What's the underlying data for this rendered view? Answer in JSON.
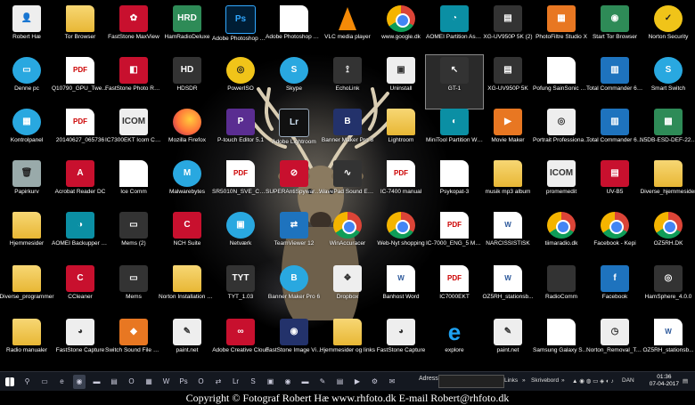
{
  "icons": [
    {
      "label": "Robert Hæ",
      "type": "white",
      "glyph": "👤",
      "icon": "user-folder-icon",
      "col": 0,
      "row": 0
    },
    {
      "label": "Tor Browser",
      "type": "folder",
      "glyph": "",
      "icon": "folder-icon",
      "col": 1,
      "row": 0
    },
    {
      "label": "FastStone MaxView",
      "type": "red",
      "glyph": "✿",
      "icon": "faststone-maxview-icon",
      "col": 2,
      "row": 0
    },
    {
      "label": "HamRadioDeluxe",
      "type": "green",
      "glyph": "HRD",
      "icon": "ham-radio-deluxe-icon",
      "col": 3,
      "row": 0
    },
    {
      "label": "Adobe Photoshop CC 2017",
      "type": "ps",
      "glyph": "Ps",
      "icon": "photoshop-icon",
      "col": 4,
      "row": 0
    },
    {
      "label": "Adobe Photoshop CC 2015.5",
      "type": "blank",
      "glyph": "",
      "icon": "blank-document-icon",
      "col": 5,
      "row": 0
    },
    {
      "label": "VLC media player",
      "type": "vlc",
      "glyph": "",
      "icon": "vlc-cone-icon",
      "col": 6,
      "row": 0
    },
    {
      "label": "www.google.dk",
      "type": "chrome",
      "glyph": "",
      "icon": "chrome-icon",
      "col": 7,
      "row": 0
    },
    {
      "label": "AOMEI Partition Assistant Pro Editi...",
      "type": "teal",
      "glyph": "◔",
      "icon": "aomei-partition-icon",
      "col": 8,
      "row": 0
    },
    {
      "label": "XG-UV950P 5K (2)",
      "type": "dark",
      "glyph": "▤",
      "icon": "radio-transceiver-icon",
      "col": 9,
      "row": 0
    },
    {
      "label": "PhotoFiltre Studio X",
      "type": "orange",
      "glyph": "▦",
      "icon": "photofiltre-icon",
      "col": 10,
      "row": 0
    },
    {
      "label": "Start Tor Browser",
      "type": "green",
      "glyph": "◉",
      "icon": "tor-onion-icon",
      "col": 11,
      "row": 0
    },
    {
      "label": "Norton Security",
      "type": "yellow",
      "glyph": "✓",
      "icon": "norton-icon",
      "col": 12,
      "row": 0
    },
    {
      "label": "Denne pc",
      "type": "lightblue",
      "glyph": "▭",
      "icon": "computer-icon",
      "col": 0,
      "row": 1
    },
    {
      "label": "Q10790_GPU_Tweak...",
      "type": "pdf",
      "glyph": "PDF",
      "icon": "pdf-icon",
      "col": 1,
      "row": 1
    },
    {
      "label": "FastStone Photo Resizer",
      "type": "red",
      "glyph": "◧",
      "icon": "faststone-resizer-icon",
      "col": 2,
      "row": 1
    },
    {
      "label": "HDSDR",
      "type": "dark",
      "glyph": "HD",
      "icon": "hdsdr-icon",
      "col": 3,
      "row": 1
    },
    {
      "label": "PowerISO",
      "type": "yellow",
      "glyph": "◎",
      "icon": "poweriso-disc-icon",
      "col": 4,
      "row": 1
    },
    {
      "label": "Skype",
      "type": "lightblue",
      "glyph": "S",
      "icon": "skype-icon",
      "col": 5,
      "row": 1
    },
    {
      "label": "EchoLink",
      "type": "dark",
      "glyph": "⟟",
      "icon": "echolink-tower-icon",
      "col": 6,
      "row": 1
    },
    {
      "label": "Uninstall",
      "type": "white",
      "glyph": "▣",
      "icon": "uninstall-icon",
      "col": 7,
      "row": 1
    },
    {
      "label": "GT-1",
      "type": "dark",
      "glyph": "↖",
      "icon": "gt1-icon",
      "col": 8,
      "row": 1,
      "selected": true
    },
    {
      "label": "XG-UV950P 5K",
      "type": "dark",
      "glyph": "▤",
      "icon": "radio-transceiver-icon",
      "col": 9,
      "row": 1
    },
    {
      "label": "Pofung SainSonic GT-1",
      "type": "blank",
      "glyph": "",
      "icon": "blank-document-icon",
      "col": 10,
      "row": 1
    },
    {
      "label": "Total Commander 64 bit (2)",
      "type": "blue",
      "glyph": "▥",
      "icon": "total-commander-icon",
      "col": 11,
      "row": 1
    },
    {
      "label": "Smart Switch",
      "type": "lightblue",
      "glyph": "S",
      "icon": "smart-switch-icon",
      "col": 12,
      "row": 1
    },
    {
      "label": "Kontrolpanel",
      "type": "lightblue",
      "glyph": "▦",
      "icon": "control-panel-icon",
      "col": 0,
      "row": 2
    },
    {
      "label": "20140627_065736",
      "type": "pdf",
      "glyph": "PDF",
      "icon": "pdf-icon",
      "col": 1,
      "row": 2
    },
    {
      "label": "IC7300EKT Icom CAT Control",
      "type": "white",
      "glyph": "ICOM",
      "icon": "icom-icon",
      "col": 2,
      "row": 2
    },
    {
      "label": "Mozilla Firefox",
      "type": "firefox",
      "glyph": "",
      "icon": "firefox-icon",
      "col": 3,
      "row": 2
    },
    {
      "label": "P-touch Editor 5.1",
      "type": "purple",
      "glyph": "P",
      "icon": "ptouch-icon",
      "col": 4,
      "row": 2
    },
    {
      "label": "Adobe Lightroom",
      "type": "lr",
      "glyph": "Lr",
      "icon": "lightroom-icon",
      "col": 5,
      "row": 2
    },
    {
      "label": "Banner Maker Pro 8",
      "type": "navy",
      "glyph": "B",
      "icon": "banner-maker-icon",
      "col": 6,
      "row": 2
    },
    {
      "label": "Lightroom",
      "type": "folder",
      "glyph": "",
      "icon": "folder-icon",
      "col": 7,
      "row": 2
    },
    {
      "label": "MiniTool Partition Wizard",
      "type": "teal",
      "glyph": "◐",
      "icon": "minitool-icon",
      "col": 8,
      "row": 2
    },
    {
      "label": "Movie Maker",
      "type": "orange",
      "glyph": "▶",
      "icon": "movie-maker-icon",
      "col": 9,
      "row": 2
    },
    {
      "label": "Portrait Professional 11",
      "type": "white",
      "glyph": "◎",
      "icon": "camera-icon",
      "col": 10,
      "row": 2
    },
    {
      "label": "Total Commander 64 bit",
      "type": "blue",
      "glyph": "▥",
      "icon": "total-commander-icon",
      "col": 11,
      "row": 2
    },
    {
      "label": "N5DB-ESD-DEF-22.6...",
      "type": "green",
      "glyph": "▩",
      "icon": "archive-icon",
      "col": 12,
      "row": 2
    },
    {
      "label": "Papirkurv",
      "type": "gray",
      "glyph": "🗑",
      "icon": "recycle-bin-icon",
      "col": 0,
      "row": 3
    },
    {
      "label": "Acrobat Reader DC",
      "type": "red",
      "glyph": "A",
      "icon": "acrobat-icon",
      "col": 1,
      "row": 3
    },
    {
      "label": "Ice Comm",
      "type": "blank",
      "glyph": "",
      "icon": "blank-document-icon",
      "col": 2,
      "row": 3
    },
    {
      "label": "Malwarebytes",
      "type": "lightblue",
      "glyph": "M",
      "icon": "malwarebytes-icon",
      "col": 3,
      "row": 3
    },
    {
      "label": "SR5010N_SVE_CD-Rom",
      "type": "pdf",
      "glyph": "PDF",
      "icon": "pdf-icon",
      "col": 4,
      "row": 3
    },
    {
      "label": "SUPERAntiSpyware Professional",
      "type": "red",
      "glyph": "⊘",
      "icon": "antispyware-icon",
      "col": 5,
      "row": 3
    },
    {
      "label": "WavePad Sound Editor",
      "type": "dark",
      "glyph": "∿",
      "icon": "wavepad-icon",
      "col": 6,
      "row": 3
    },
    {
      "label": "IC-7400 manual",
      "type": "pdf",
      "glyph": "PDF",
      "icon": "pdf-icon",
      "col": 7,
      "row": 3
    },
    {
      "label": "Psykopat-3",
      "type": "blank",
      "glyph": "",
      "icon": "blank-document-icon",
      "col": 8,
      "row": 3
    },
    {
      "label": "musik mp3 album",
      "type": "folder",
      "glyph": "",
      "icon": "folder-icon",
      "col": 9,
      "row": 3
    },
    {
      "label": "promemedit",
      "type": "white",
      "glyph": "ICOM",
      "icon": "icom-icon",
      "col": 10,
      "row": 3
    },
    {
      "label": "UV-B5",
      "type": "red",
      "glyph": "▤",
      "icon": "radio-transceiver-icon",
      "col": 11,
      "row": 3
    },
    {
      "label": "Diverse_hjemmesider",
      "type": "folder",
      "glyph": "",
      "icon": "folder-icon",
      "col": 12,
      "row": 3
    },
    {
      "label": "Hjemmesider",
      "type": "folder",
      "glyph": "",
      "icon": "folder-icon",
      "col": 0,
      "row": 4
    },
    {
      "label": "AOMEI Backupper Professional",
      "type": "teal",
      "glyph": "◑",
      "icon": "aomei-backupper-icon",
      "col": 1,
      "row": 4
    },
    {
      "label": "Mems (2)",
      "type": "dark",
      "glyph": "▭",
      "icon": "mems-icon",
      "col": 2,
      "row": 4
    },
    {
      "label": "NCH Suite",
      "type": "red",
      "glyph": "C",
      "icon": "nch-suite-icon",
      "col": 3,
      "row": 4
    },
    {
      "label": "Netværk",
      "type": "lightblue",
      "glyph": "▣",
      "icon": "network-icon",
      "col": 4,
      "row": 4
    },
    {
      "label": "TeamViewer 12",
      "type": "blue",
      "glyph": "⇄",
      "icon": "teamviewer-icon",
      "col": 5,
      "row": 4
    },
    {
      "label": "WinAccuracer",
      "type": "chrome",
      "glyph": "",
      "icon": "chrome-icon",
      "col": 6,
      "row": 4
    },
    {
      "label": "Web-Nyt shopping",
      "type": "chrome",
      "glyph": "",
      "icon": "chrome-icon",
      "col": 7,
      "row": 4
    },
    {
      "label": "IC-7000_ENG_5 Manual",
      "type": "pdf",
      "glyph": "PDF",
      "icon": "pdf-icon",
      "col": 8,
      "row": 4
    },
    {
      "label": "NARCISSISTISK",
      "type": "doc",
      "glyph": "W",
      "icon": "word-document-icon",
      "col": 9,
      "row": 4
    },
    {
      "label": "tiimaradio.dk",
      "type": "chrome",
      "glyph": "",
      "icon": "chrome-icon",
      "col": 10,
      "row": 4
    },
    {
      "label": "Facebook - Kepi",
      "type": "chrome",
      "glyph": "",
      "icon": "chrome-icon",
      "col": 11,
      "row": 4
    },
    {
      "label": "OZ5RH.DK",
      "type": "chrome",
      "glyph": "",
      "icon": "chrome-icon",
      "col": 12,
      "row": 4
    },
    {
      "label": "Diverse_programmer",
      "type": "folder",
      "glyph": "",
      "icon": "folder-icon",
      "col": 0,
      "row": 5
    },
    {
      "label": "CCleaner",
      "type": "red",
      "glyph": "C",
      "icon": "ccleaner-icon",
      "col": 1,
      "row": 5
    },
    {
      "label": "Mems",
      "type": "dark",
      "glyph": "▭",
      "icon": "mems-icon",
      "col": 2,
      "row": 5
    },
    {
      "label": "Norton Installation Files",
      "type": "folder",
      "glyph": "",
      "icon": "folder-icon",
      "col": 3,
      "row": 5
    },
    {
      "label": "TYT_1.03",
      "type": "dark",
      "glyph": "TYT",
      "icon": "tyt-icon",
      "col": 4,
      "row": 5
    },
    {
      "label": "Banner Maker Pro 6",
      "type": "lightblue",
      "glyph": "B",
      "icon": "banner-maker-icon",
      "col": 5,
      "row": 5
    },
    {
      "label": "Dropbox",
      "type": "white",
      "glyph": "❖",
      "icon": "dropbox-icon",
      "col": 6,
      "row": 5
    },
    {
      "label": "Banhost Word",
      "type": "doc",
      "glyph": "W",
      "icon": "word-document-icon",
      "col": 7,
      "row": 5
    },
    {
      "label": "IC7000EKT",
      "type": "pdf",
      "glyph": "PDF",
      "icon": "pdf-icon",
      "col": 8,
      "row": 5
    },
    {
      "label": "OZ5RH_stationsb...",
      "type": "doc",
      "glyph": "W",
      "icon": "word-document-icon",
      "col": 9,
      "row": 5
    },
    {
      "label": "RadioComm",
      "type": "dark",
      "glyph": "",
      "icon": "radiocomm-icon",
      "col": 10,
      "row": 5
    },
    {
      "label": "Facebook",
      "type": "blue",
      "glyph": "f",
      "icon": "facebook-icon",
      "col": 11,
      "row": 5
    },
    {
      "label": "HamSphere_4.0.0",
      "type": "dark",
      "glyph": "◎",
      "icon": "hamsphere-icon",
      "col": 12,
      "row": 5
    },
    {
      "label": "Radio manualer",
      "type": "folder",
      "glyph": "",
      "icon": "folder-icon",
      "col": 0,
      "row": 6
    },
    {
      "label": "FastStone Capture",
      "type": "white",
      "glyph": "◕",
      "icon": "faststone-capture-icon",
      "col": 1,
      "row": 6
    },
    {
      "label": "Switch Sound File Converter",
      "type": "orange",
      "glyph": "◆",
      "icon": "switch-converter-icon",
      "col": 2,
      "row": 6
    },
    {
      "label": "paint.net",
      "type": "white",
      "glyph": "✎",
      "icon": "paintnet-icon",
      "col": 3,
      "row": 6
    },
    {
      "label": "Adobe Creative Cloud",
      "type": "red",
      "glyph": "∞",
      "icon": "creative-cloud-icon",
      "col": 4,
      "row": 6
    },
    {
      "label": "FastStone Image Viewer",
      "type": "navy",
      "glyph": "◉",
      "icon": "faststone-viewer-icon",
      "col": 5,
      "row": 6
    },
    {
      "label": "Hjemmesider og links",
      "type": "folder",
      "glyph": "",
      "icon": "folder-icon",
      "col": 6,
      "row": 6
    },
    {
      "label": "FastStone Capture",
      "type": "white",
      "glyph": "◕",
      "icon": "faststone-capture-icon",
      "col": 7,
      "row": 6
    },
    {
      "label": "explore",
      "type": "ie",
      "glyph": "e",
      "icon": "internet-explorer-icon",
      "col": 8,
      "row": 6
    },
    {
      "label": "paint.net",
      "type": "white",
      "glyph": "✎",
      "icon": "paintnet-icon",
      "col": 9,
      "row": 6
    },
    {
      "label": "Samsung Galaxy S7 edge - Genvej (2)",
      "type": "blank",
      "glyph": "",
      "icon": "blank-document-icon",
      "col": 10,
      "row": 6
    },
    {
      "label": "Norton_Removal_Tool",
      "type": "white",
      "glyph": "◷",
      "icon": "norton-removal-icon",
      "col": 11,
      "row": 6
    },
    {
      "label": "OZ5RH_stationsb...",
      "type": "doc",
      "glyph": "W",
      "icon": "word-document-icon",
      "col": 12,
      "row": 6
    }
  ],
  "taskbar": {
    "buttons": [
      {
        "icon": "start-windows-icon",
        "glyph": "",
        "active": false
      },
      {
        "icon": "search-icon",
        "glyph": "⚲",
        "active": false
      },
      {
        "icon": "task-view-icon",
        "glyph": "▭",
        "active": false
      },
      {
        "icon": "edge-icon",
        "glyph": "e",
        "active": false
      },
      {
        "icon": "chrome-taskbar-icon",
        "glyph": "◉",
        "active": true
      },
      {
        "icon": "file-explorer-icon",
        "glyph": "▬",
        "active": false
      },
      {
        "icon": "store-icon",
        "glyph": "▤",
        "active": false
      },
      {
        "icon": "outlook-icon",
        "glyph": "O",
        "active": false
      },
      {
        "icon": "calculator-icon",
        "glyph": "▦",
        "active": false
      },
      {
        "icon": "word-taskbar-icon",
        "glyph": "W",
        "active": false
      },
      {
        "icon": "photoshop-taskbar-icon",
        "glyph": "Ps",
        "active": false
      },
      {
        "icon": "outlook-taskbar-icon",
        "glyph": "O",
        "active": false
      },
      {
        "icon": "teamviewer-taskbar-icon",
        "glyph": "⇄",
        "active": false
      },
      {
        "icon": "lightroom-taskbar-icon",
        "glyph": "Lr",
        "active": false
      },
      {
        "icon": "skype-taskbar-icon",
        "glyph": "S",
        "active": false
      },
      {
        "icon": "photo-taskbar-icon",
        "glyph": "▣",
        "active": false
      },
      {
        "icon": "chrome-taskbar-icon-2",
        "glyph": "◉",
        "active": false
      },
      {
        "icon": "explorer-taskbar-icon",
        "glyph": "▬",
        "active": false
      },
      {
        "icon": "paint-taskbar-icon",
        "glyph": "✎",
        "active": false
      },
      {
        "icon": "notes-taskbar-icon",
        "glyph": "▤",
        "active": false
      },
      {
        "icon": "media-taskbar-icon",
        "glyph": "▶",
        "active": false
      },
      {
        "icon": "settings-taskbar-icon",
        "glyph": "⚙",
        "active": false
      },
      {
        "icon": "mail-taskbar-icon",
        "glyph": "✉",
        "active": false
      }
    ],
    "address_label": "Adresse",
    "address_value": "",
    "links_label": "Links",
    "desktop_label": "Skrivebord",
    "language": "DAN",
    "time": "01:36",
    "date": "07-04-2017"
  },
  "copyright": "Copyright © Fotograf Robert Hæ www.rhfoto.dk E-mail Robert@rhfoto.dk"
}
